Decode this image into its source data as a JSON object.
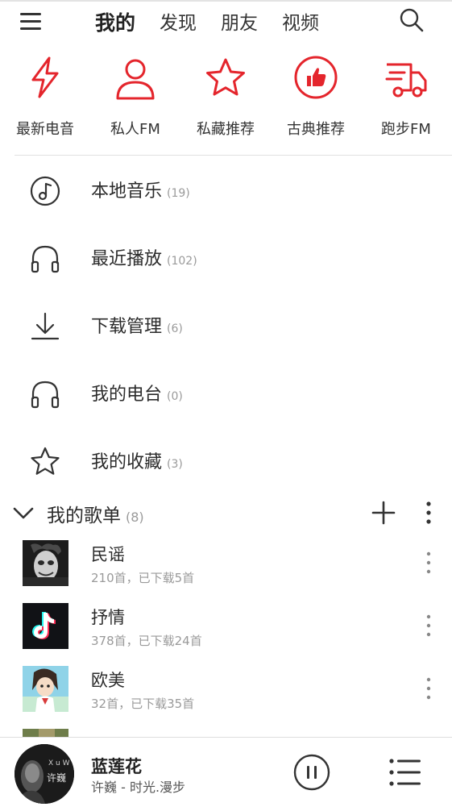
{
  "header": {
    "tabs": [
      {
        "label": "我的",
        "active": true
      },
      {
        "label": "发现",
        "active": false
      },
      {
        "label": "朋友",
        "active": false
      },
      {
        "label": "视频",
        "active": false
      }
    ],
    "menu_icon": "hamburger-menu-icon",
    "search_icon": "search-icon"
  },
  "quick": [
    {
      "label": "最新电音",
      "icon": "lightning-icon"
    },
    {
      "label": "私人FM",
      "icon": "person-icon"
    },
    {
      "label": "私藏推荐",
      "icon": "star-icon"
    },
    {
      "label": "古典推荐",
      "icon": "thumbs-up-icon"
    },
    {
      "label": "跑步FM",
      "icon": "running-icon"
    }
  ],
  "library": [
    {
      "label": "本地音乐",
      "count": "(19)",
      "icon": "music-note-icon"
    },
    {
      "label": "最近播放",
      "count": "(102)",
      "icon": "headphones-icon"
    },
    {
      "label": "下载管理",
      "count": "(6)",
      "icon": "download-icon"
    },
    {
      "label": "我的电台",
      "count": "(0)",
      "icon": "headphones-icon"
    },
    {
      "label": "我的收藏",
      "count": "(3)",
      "icon": "star-outline-icon"
    }
  ],
  "playlists_section": {
    "title": "我的歌单",
    "count": "(8)"
  },
  "playlists": [
    {
      "name": "民谣",
      "sub": "210首，已下载5首"
    },
    {
      "name": "抒情",
      "sub": "378首，已下载24首"
    },
    {
      "name": "欧美",
      "sub": "32首，已下载35首"
    }
  ],
  "player": {
    "title": "蓝莲花",
    "subtitle": "许巍 - 时光.漫步",
    "cover_text": "许巍"
  },
  "colors": {
    "accent_red": "#e4252c",
    "text_dark": "#2b2b2b",
    "text_gray": "#9a9a9a"
  }
}
